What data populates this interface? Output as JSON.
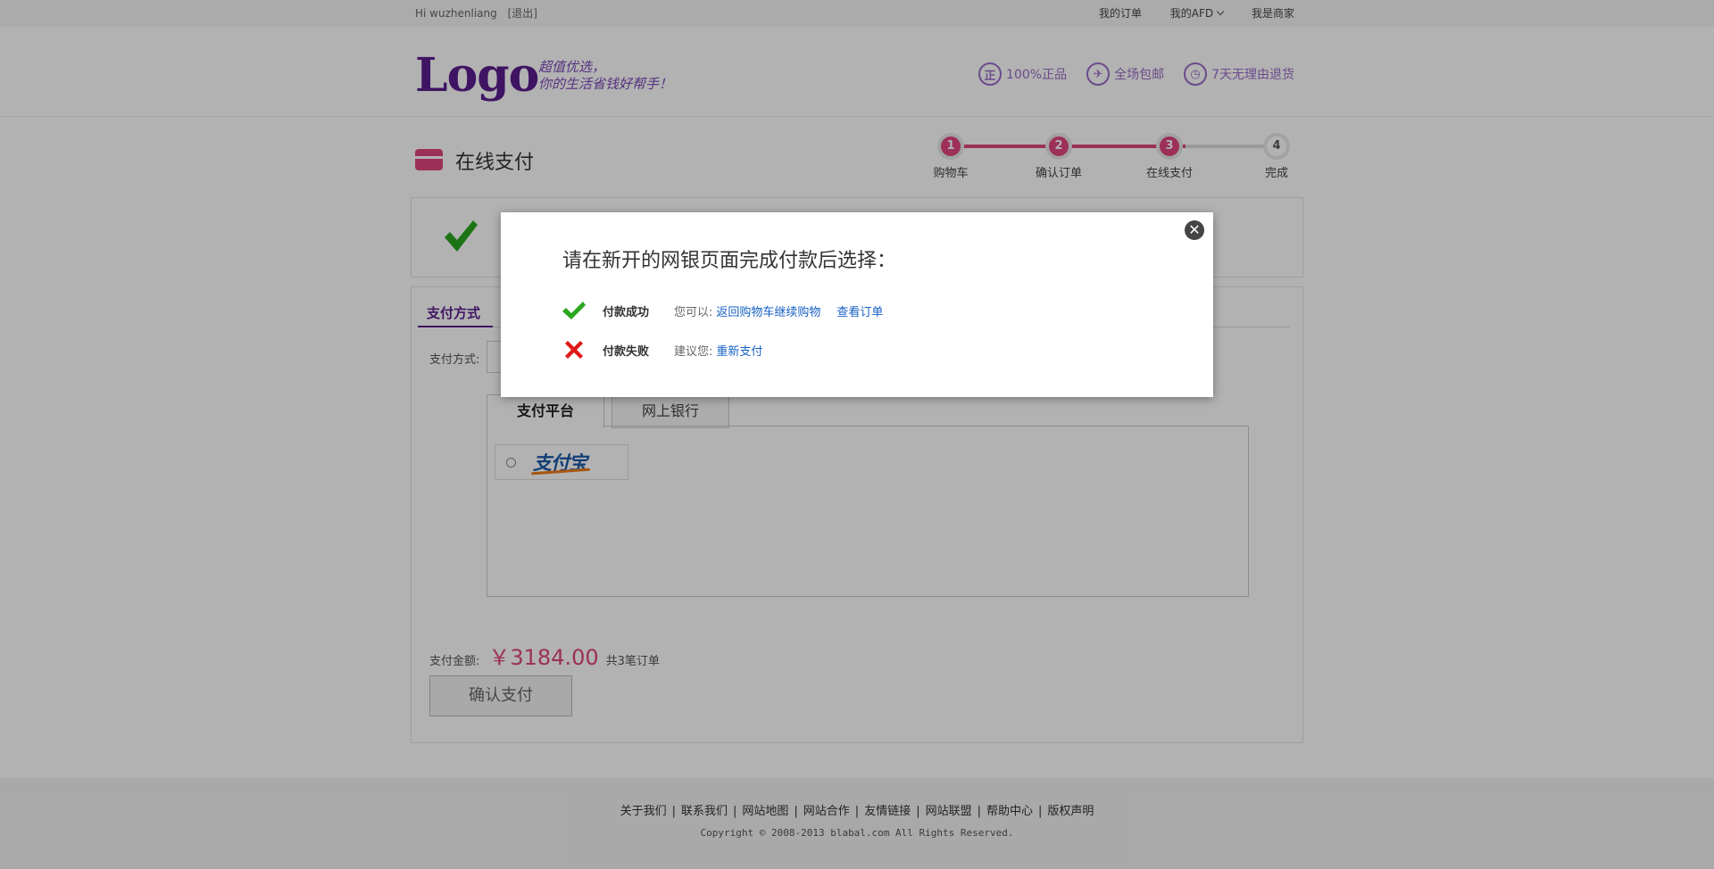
{
  "topbar": {
    "greeting": "Hi wuzhenliang",
    "logout": "[退出]",
    "my_orders": "我的订单",
    "my_afd": "我的AFD",
    "merchant": "我是商家"
  },
  "header": {
    "logo": "Logo",
    "slogan_line1": "超值优选，",
    "slogan_line2": "你的生活省钱好帮手！",
    "promises": [
      {
        "icon": "genuine-icon",
        "glyph": "正",
        "label": "100%正品"
      },
      {
        "icon": "free-shipping-icon",
        "glyph": "✈",
        "label": "全场包邮"
      },
      {
        "icon": "clock-icon",
        "glyph": "◷",
        "label": "7天无理由退货"
      }
    ]
  },
  "page": {
    "title": "在线支付",
    "steps": [
      {
        "num": "1",
        "label": "购物车",
        "done": true
      },
      {
        "num": "2",
        "label": "确认订单",
        "done": true
      },
      {
        "num": "3",
        "label": "在线支付",
        "done": true
      },
      {
        "num": "4",
        "label": "完成",
        "done": false
      }
    ]
  },
  "payment": {
    "section_title": "支付方式",
    "method_label": "支付方式:",
    "tabs": [
      "支付平台",
      "网上银行"
    ],
    "alipay_logo": "支付宝",
    "amount_label": "支付金额:",
    "amount": "￥3184.00",
    "order_count": "共3笔订单",
    "confirm_button": "确认支付"
  },
  "dialog": {
    "title": "请在新开的网银页面完成付款后选择：",
    "success_status": "付款成功",
    "success_hint": "您可以:",
    "success_link1": "返回购物车继续购物",
    "success_link2": "查看订单",
    "fail_status": "付款失败",
    "fail_hint": "建议您:",
    "fail_link": "重新支付",
    "close": "✕"
  },
  "footer": {
    "links": [
      "关于我们",
      "联系我们",
      "网站地图",
      "网站合作",
      "友情链接",
      "网站联盟",
      "帮助中心",
      "版权声明"
    ],
    "copyright": "Copyright © 2008-2013 blabal.com All Rights Reserved."
  },
  "colors": {
    "brand_purple": "#5b1e8f",
    "accent_pink": "#e0457e",
    "link_blue": "#1660c4",
    "success_green": "#2aa71f",
    "fail_red": "#e01818"
  }
}
